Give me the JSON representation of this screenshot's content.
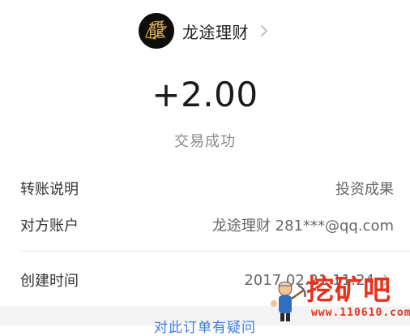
{
  "header": {
    "merchant_name": "龙途理财",
    "logo_glyph": "龍",
    "logo_icon": "dragon-logo-icon",
    "chevron_icon": "chevron-right-icon"
  },
  "transaction": {
    "amount": "+2.00",
    "status": "交易成功"
  },
  "details": {
    "description_label": "转账说明",
    "description_value": "投资成果",
    "account_label": "对方账户",
    "account_value": "龙途理财 281***@qq.com",
    "time_label": "创建时间",
    "time_value": "2017.02.21 11:24"
  },
  "footer": {
    "question_link": "对此订单有疑问"
  },
  "watermark": {
    "title": "挖矿吧",
    "url": "www.110610.com"
  },
  "colors": {
    "link": "#3b7be0",
    "watermark": "#e8321e",
    "logo_gold": "#c9a04a"
  }
}
